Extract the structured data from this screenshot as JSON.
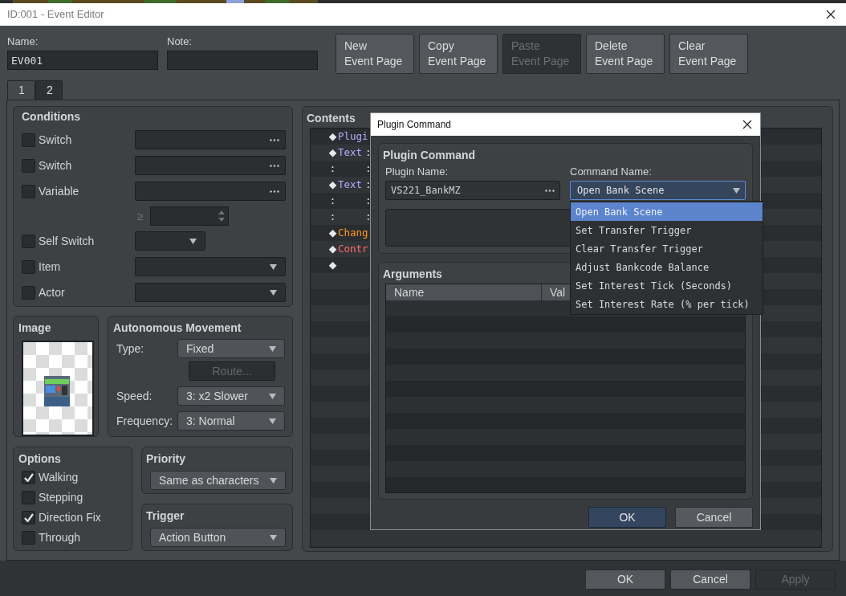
{
  "window": {
    "title": "ID:001 - Event Editor"
  },
  "name_field": {
    "label": "Name:",
    "value": "EV001"
  },
  "note_field": {
    "label": "Note:"
  },
  "page_buttons": [
    {
      "lines": [
        "New",
        "Event Page"
      ],
      "disabled": false
    },
    {
      "lines": [
        "Copy",
        "Event Page"
      ],
      "disabled": false
    },
    {
      "lines": [
        "Paste",
        "Event Page"
      ],
      "disabled": true
    },
    {
      "lines": [
        "Delete",
        "Event Page"
      ],
      "disabled": false
    },
    {
      "lines": [
        "Clear",
        "Event Page"
      ],
      "disabled": false
    }
  ],
  "tabs": [
    {
      "label": "1",
      "selected": true
    },
    {
      "label": "2",
      "selected": false
    }
  ],
  "conditions": {
    "title": "Conditions",
    "rows": [
      {
        "kind": "picker",
        "label": "Switch",
        "checked": false
      },
      {
        "kind": "picker",
        "label": "Switch",
        "checked": false
      },
      {
        "kind": "picker",
        "label": "Variable",
        "checked": false
      },
      {
        "kind": "spinner",
        "symbol": "≥"
      },
      {
        "kind": "short_dropdown",
        "label": "Self Switch",
        "checked": false
      },
      {
        "kind": "dropdown",
        "label": "Item",
        "checked": false
      },
      {
        "kind": "dropdown",
        "label": "Actor",
        "checked": false
      }
    ]
  },
  "image": {
    "title": "Image"
  },
  "autonomous_movement": {
    "title": "Autonomous Movement",
    "type": {
      "label": "Type:",
      "value": "Fixed"
    },
    "route_button": {
      "label": "Route...",
      "disabled": true
    },
    "speed": {
      "label": "Speed:",
      "value": "3: x2 Slower"
    },
    "frequency": {
      "label": "Frequency:",
      "value": "3: Normal"
    }
  },
  "options": {
    "title": "Options",
    "items": [
      {
        "label": "Walking",
        "checked": true
      },
      {
        "label": "Stepping",
        "checked": false
      },
      {
        "label": "Direction Fix",
        "checked": true
      },
      {
        "label": "Through",
        "checked": false
      }
    ]
  },
  "priority": {
    "title": "Priority",
    "value": "Same as characters"
  },
  "trigger": {
    "title": "Trigger",
    "value": "Action Button"
  },
  "contents": {
    "title": "Contents",
    "lines": [
      {
        "kind": "command",
        "marker": "◆",
        "parts": [
          "Plugi"
        ],
        "color": "#b9a9ff"
      },
      {
        "kind": "command",
        "marker": "◆",
        "parts": [
          "Text",
          ":"
        ],
        "color": "#b9a9ff"
      },
      {
        "kind": "continuation",
        "parts": [
          ":",
          ":"
        ]
      },
      {
        "kind": "command",
        "marker": "◆",
        "parts": [
          "Text",
          ":"
        ],
        "color": "#b9a9ff"
      },
      {
        "kind": "continuation",
        "parts": [
          ":",
          ":"
        ]
      },
      {
        "kind": "continuation",
        "parts": [
          ":",
          ":"
        ]
      },
      {
        "kind": "command",
        "marker": "◆",
        "parts": [
          "Chang"
        ],
        "color": "#ff9a1a"
      },
      {
        "kind": "command",
        "marker": "◆",
        "parts": [
          "Contr"
        ],
        "color": "#ff6b6b"
      },
      {
        "kind": "command",
        "marker": "◆"
      }
    ]
  },
  "dialog": {
    "title": "Plugin Command",
    "group_title": "Plugin Command",
    "plugin_name": {
      "label": "Plugin Name:",
      "value": "VS221_BankMZ"
    },
    "command_name": {
      "label": "Command Name:",
      "value": "Open Bank Scene"
    },
    "arguments": {
      "title": "Arguments",
      "columns": [
        "Name",
        "Val"
      ]
    },
    "buttons": [
      {
        "label": "OK",
        "primary": true
      },
      {
        "label": "Cancel",
        "primary": false
      }
    ]
  },
  "command_menu": {
    "items": [
      {
        "label": "Open Bank Scene",
        "selected": true
      },
      {
        "label": "Set Transfer Trigger",
        "selected": false
      },
      {
        "label": "Clear Transfer Trigger",
        "selected": false
      },
      {
        "label": "Adjust Bankcode Balance",
        "selected": false
      },
      {
        "label": "Set Interest Tick (Seconds)",
        "selected": false
      },
      {
        "label": "Set Interest Rate (% per tick)",
        "selected": false
      }
    ]
  },
  "footer_buttons": [
    {
      "label": "OK",
      "disabled": false
    },
    {
      "label": "Cancel",
      "disabled": false
    },
    {
      "label": "Apply",
      "disabled": true
    }
  ]
}
